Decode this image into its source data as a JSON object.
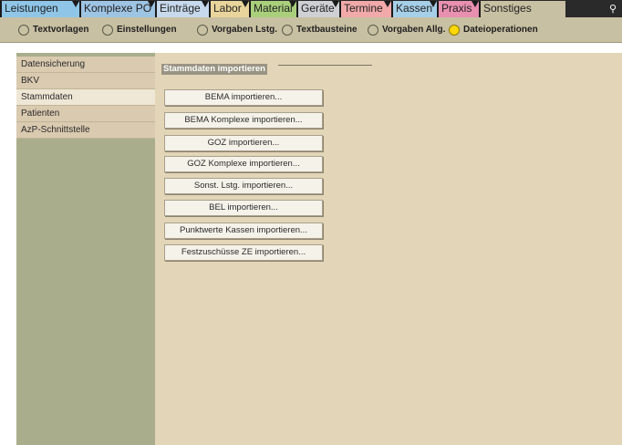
{
  "tabs": [
    {
      "label": "Leistungen",
      "color": "#8fc6e8"
    },
    {
      "label": "Komplexe PO",
      "color": "#9ec4e4"
    },
    {
      "label": "Einträge",
      "color": "#c7d9ec"
    },
    {
      "label": "Labor",
      "color": "#e9d59b"
    },
    {
      "label": "Material",
      "color": "#a9cf7b"
    },
    {
      "label": "Geräte",
      "color": "#cfd0d4"
    },
    {
      "label": "Termine",
      "color": "#f2a9a9"
    },
    {
      "label": "Kassen",
      "color": "#a6cfe8"
    },
    {
      "label": "Praxis",
      "color": "#e98fb0"
    },
    {
      "label": "Sonstiges",
      "color": "#c8c0a2"
    }
  ],
  "options": [
    {
      "label": "Textvorlagen",
      "selected": false
    },
    {
      "label": "Einstellungen",
      "selected": false
    },
    {
      "label": "Vorgaben Lstg.",
      "selected": false
    },
    {
      "label": "Textbausteine",
      "selected": false
    },
    {
      "label": "Vorgaben Allg.",
      "selected": false
    },
    {
      "label": "Dateioperationen",
      "selected": true
    }
  ],
  "sidebar": {
    "items": [
      {
        "label": "Datensicherung",
        "selected": false
      },
      {
        "label": "BKV",
        "selected": false
      },
      {
        "label": "Stammdaten",
        "selected": true
      },
      {
        "label": "Patienten",
        "selected": false
      },
      {
        "label": "AzP-Schnittstelle",
        "selected": false
      }
    ]
  },
  "content": {
    "group_title": "Stammdaten importieren",
    "buttons": [
      "BEMA importieren...",
      "BEMA Komplexe importieren...",
      "GOZ importieren...",
      "GOZ Komplexe importieren...",
      "Sonst. Lstg. importieren...",
      "BEL importieren...",
      "Punktwerte Kassen importieren...",
      "Festzuschüsse ZE importieren..."
    ]
  },
  "icons": {
    "top_right": "key-icon"
  }
}
